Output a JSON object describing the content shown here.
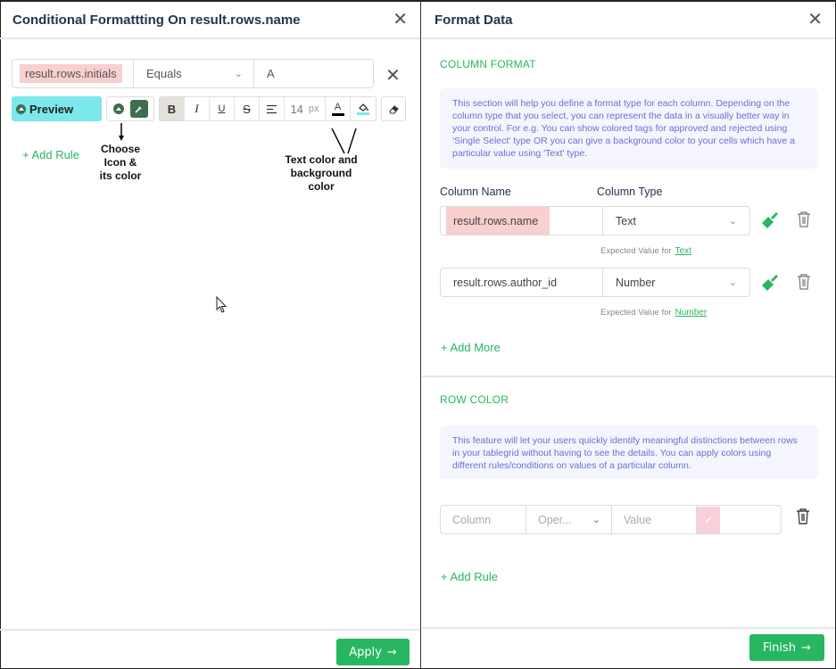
{
  "left_panel": {
    "title": "Conditional Formattting On result.rows.name",
    "rule": {
      "column": "result.rows.initials",
      "operator": "Equals",
      "value": "A"
    },
    "toolbar": {
      "preview_label": "Preview",
      "bold": "B",
      "italic": "I",
      "underline": "U",
      "strikethrough": "S",
      "font_size": "14",
      "font_unit": "px",
      "text_color_glyph": "A",
      "text_color": "#000000",
      "bg_color": "#7ce8eb",
      "icon_color": "#3f6e4e"
    },
    "add_rule_label": "+ Add Rule",
    "annotations": {
      "icon_note": [
        "Choose",
        "Icon &",
        "its color"
      ],
      "color_note": [
        "Text color and",
        "background",
        "color"
      ]
    },
    "apply_label": "Apply"
  },
  "right_panel": {
    "title": "Format Data",
    "column_format": {
      "heading": "COLUMN FORMAT",
      "info": "This section will help you define a format type for each column. Depending on the column type that you select, you can represent the data in a visually better way in your control. For e.g. You can show colored tags for approved and rejected using 'Single Select' type OR you can give a background color to your cells which have a particular value using 'Text' type.",
      "column_name_label": "Column Name",
      "column_type_label": "Column Type",
      "rows": [
        {
          "name": "result.rows.name",
          "type": "Text",
          "expected_prefix": "Expected Value for",
          "expected_link": "Text"
        },
        {
          "name": "result.rows.author_id",
          "type": "Number",
          "expected_prefix": "Expected Value for",
          "expected_link": "Number"
        }
      ],
      "add_more_label": "+ Add More"
    },
    "row_color": {
      "heading": "ROW COLOR",
      "info": "This feature will let your users quickly identify meaningful distinctions between rows in your tablegrid without having to see the details. You can apply colors using different rules/conditions on values of a particular column.",
      "column_placeholder": "Column",
      "operator_placeholder": "Oper...",
      "value_placeholder": "Value",
      "add_rule_label": "+ Add Rule"
    },
    "finish_label": "Finish"
  },
  "colors": {
    "accent_green": "#27b760",
    "highlight_pink": "#f9cfd0",
    "preview_cyan": "#7ce8eb",
    "info_text": "#6b6fd4"
  }
}
